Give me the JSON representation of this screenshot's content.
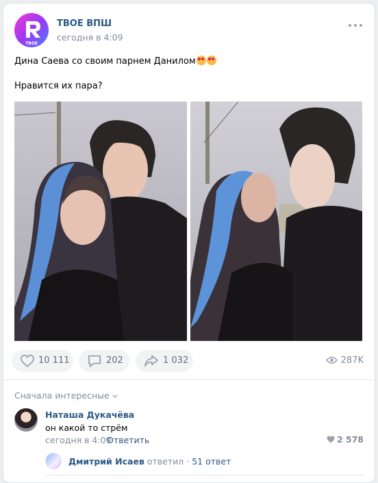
{
  "post": {
    "author": "ТВОЕ ВПШ",
    "time": "сегодня в 4:09",
    "avatar_text": "TBOE",
    "text_line1": "Дина Саева со своим парнем Данилом",
    "text_line2": "Нравится их пара?"
  },
  "actions": {
    "likes": "10 111",
    "comments": "202",
    "shares": "1 032",
    "views": "287K"
  },
  "comments_sort": "Сначала интересные",
  "comment": {
    "author": "Наташа Дукачёва",
    "text": "он какой то стрём",
    "time": "сегодня в 4:09",
    "reply_label": "Ответить",
    "likes": "2 578"
  },
  "reply_thread": {
    "author": "Дмитрий Исаев",
    "replied_label": "ответил",
    "separator": "·",
    "count": "51 ответ"
  },
  "colors": {
    "link": "#2a5885",
    "secondary": "#818c99",
    "background": "#edeef0",
    "action_bg": "#f2f3f5"
  }
}
